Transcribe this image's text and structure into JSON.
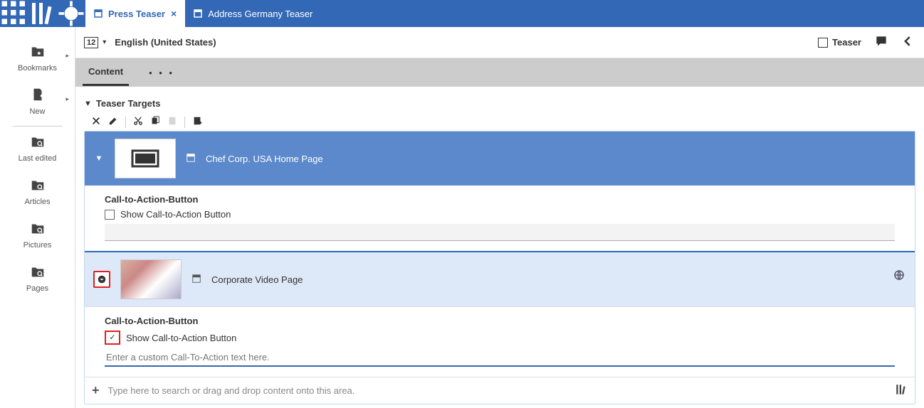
{
  "tabs": [
    {
      "label": "Press Teaser",
      "active": true
    },
    {
      "label": "Address Germany Teaser",
      "active": false
    }
  ],
  "sidebar": {
    "items": [
      {
        "label": "Bookmarks",
        "arrow": true
      },
      {
        "label": "New",
        "arrow": true
      },
      {
        "label": "Last edited",
        "arrow": false
      },
      {
        "label": "Articles",
        "arrow": false
      },
      {
        "label": "Pictures",
        "arrow": false
      },
      {
        "label": "Pages",
        "arrow": false
      }
    ]
  },
  "locale": {
    "badge": "12",
    "name": "English (United States)"
  },
  "typeLabel": "Teaser",
  "contentTabs": {
    "content": "Content",
    "more": "• • •"
  },
  "panel": {
    "title": "Teaser Targets"
  },
  "targets": [
    {
      "label": "Chef Corp. USA Home Page",
      "cta": {
        "title": "Call-to-Action-Button",
        "checkLabel": "Show Call-to-Action Button",
        "checked": false,
        "placeholder": ""
      }
    },
    {
      "label": "Corporate Video Page",
      "cta": {
        "title": "Call-to-Action-Button",
        "checkLabel": "Show Call-to-Action Button",
        "checked": true,
        "placeholder": "Enter a custom Call-To-Action text here."
      }
    }
  ],
  "addRow": {
    "hint": "Type here to search or drag and drop content onto this area."
  }
}
